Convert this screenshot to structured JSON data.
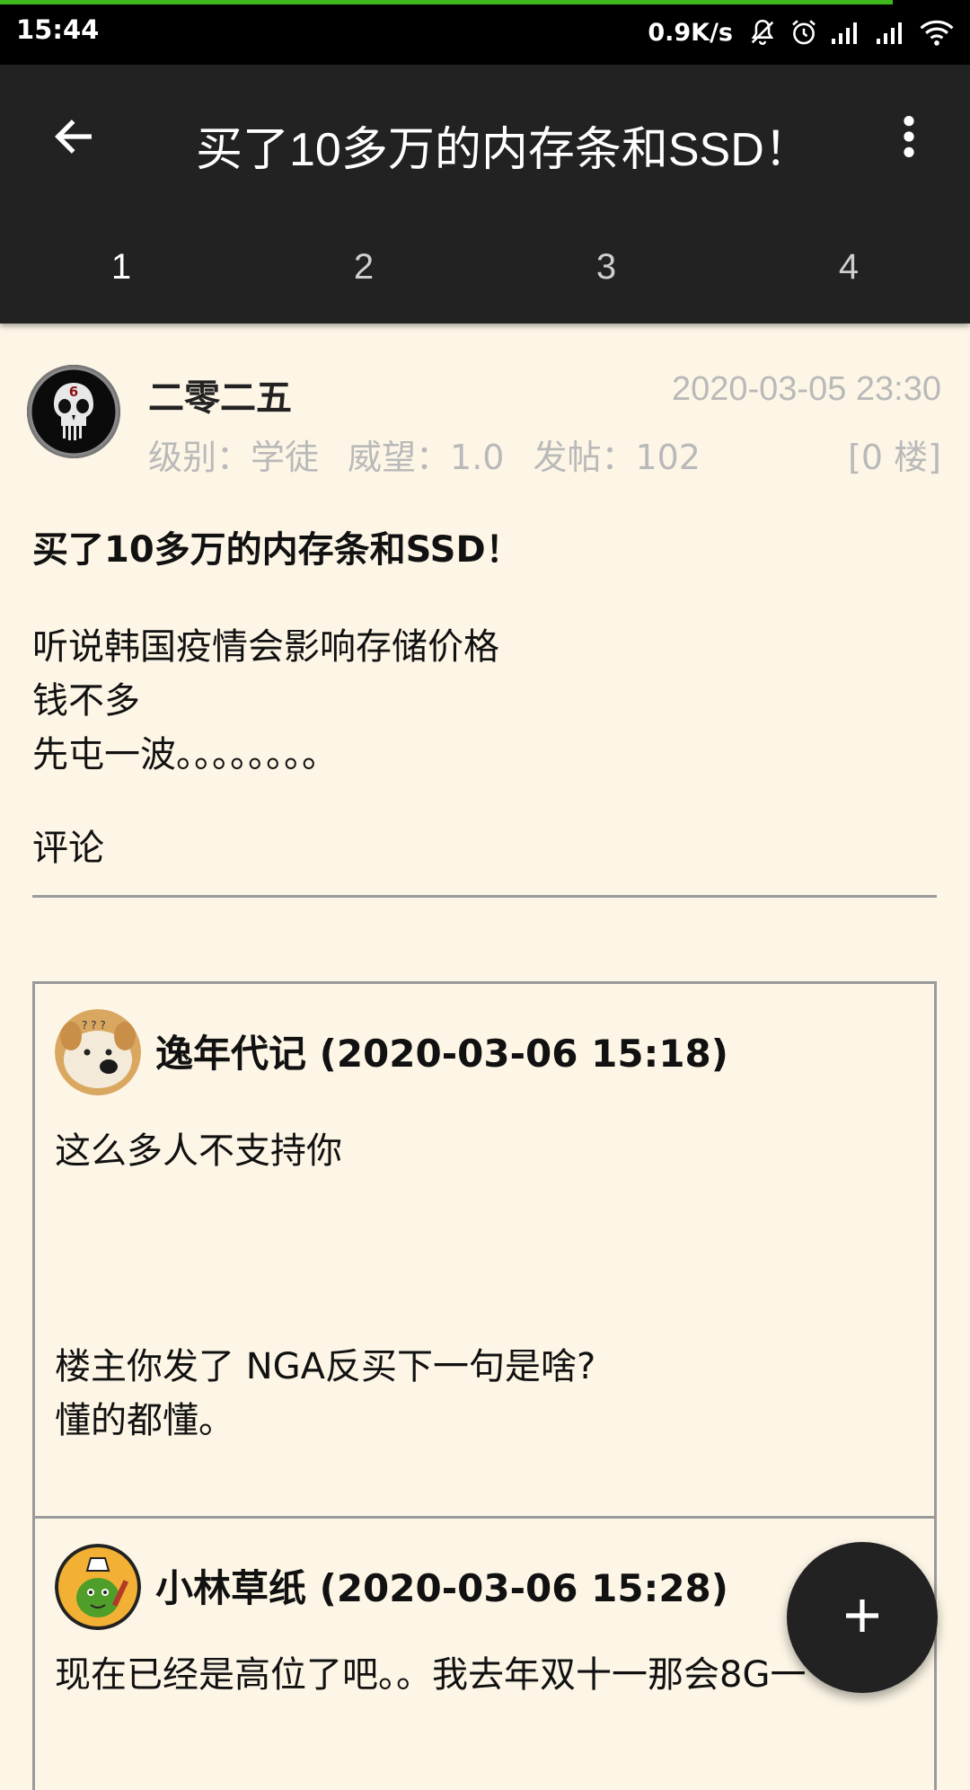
{
  "status_bar": {
    "time": "15:44",
    "net_speed": "0.9K/s",
    "icons": [
      "mute-bell-icon",
      "alarm-icon",
      "signal-icon",
      "signal-icon",
      "wifi-icon"
    ],
    "load_progress": 0.92
  },
  "app_bar": {
    "title": "买了10多万的内存条和SSD！",
    "tabs": [
      {
        "label": "1"
      },
      {
        "label": "2"
      },
      {
        "label": "3"
      },
      {
        "label": "4"
      }
    ],
    "active_tab": 0
  },
  "post": {
    "author": "二零二五",
    "date": "2020-03-05 23:30",
    "level": "级别：学徒",
    "prestige": "威望：1.0",
    "posts": "发帖：102",
    "floor": "[0 楼]",
    "title": "买了10多万的内存条和SSD！",
    "body": [
      "听说韩国疫情会影响存储价格",
      "钱不多",
      "先屯一波。。。。。。。。"
    ],
    "comments_label": "评论"
  },
  "comments": [
    {
      "header": "逸年代记 (2020-03-06 15:18)",
      "body_lines": [
        "这么多人不支持你",
        "",
        "",
        "",
        "楼主你发了 NGA反买下一句是啥?",
        "懂的都懂。"
      ]
    },
    {
      "header": "小林草纸 (2020-03-06 15:28)",
      "body_lines": [
        "现在已经是高位了吧。。我去年双十一那会8G一"
      ]
    }
  ],
  "colors": {
    "background": "#FDF6E6",
    "app_bar": "#222222",
    "progress": "#3FB81E",
    "muted_text": "#B9B9B9"
  }
}
